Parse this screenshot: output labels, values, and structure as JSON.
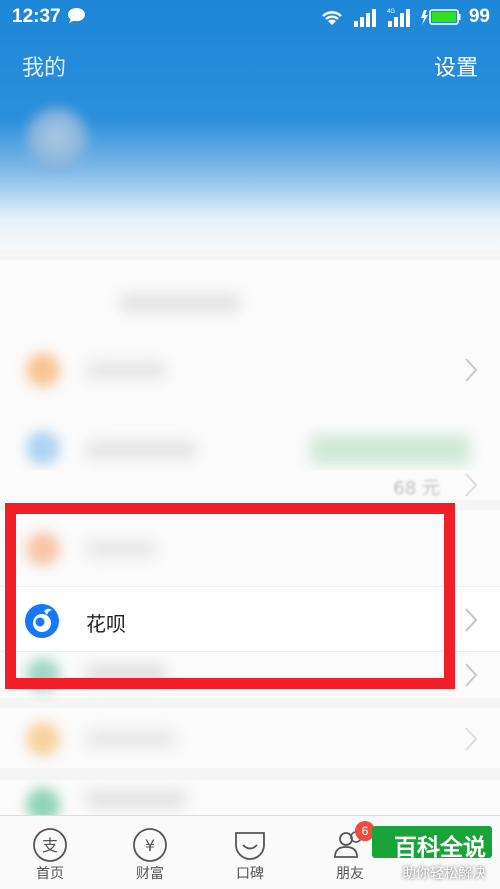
{
  "status_bar": {
    "time": "12:37",
    "battery": "99",
    "network_label": "4G"
  },
  "nav": {
    "title": "我的",
    "settings_label": "设置"
  },
  "list": {
    "huabei_label": "花呗"
  },
  "blurred": {
    "amount_hint": "68 元"
  },
  "tabbar": {
    "items": [
      {
        "label": "首页",
        "icon": "home-icon"
      },
      {
        "label": "财富",
        "icon": "wealth-icon"
      },
      {
        "label": "口碑",
        "icon": "koubei-icon"
      },
      {
        "label": "朋友",
        "icon": "friends-icon"
      }
    ],
    "friends_badge": "6"
  },
  "watermark": {
    "title": "百科全说",
    "subtitle": "助你轻松解决"
  },
  "colors": {
    "header_blue": "#1d86d6",
    "highlight_red": "#f21e27",
    "huabei_blue": "#1677ff",
    "badge_red": "#f34a3f",
    "watermark_green": "#19a43a"
  }
}
